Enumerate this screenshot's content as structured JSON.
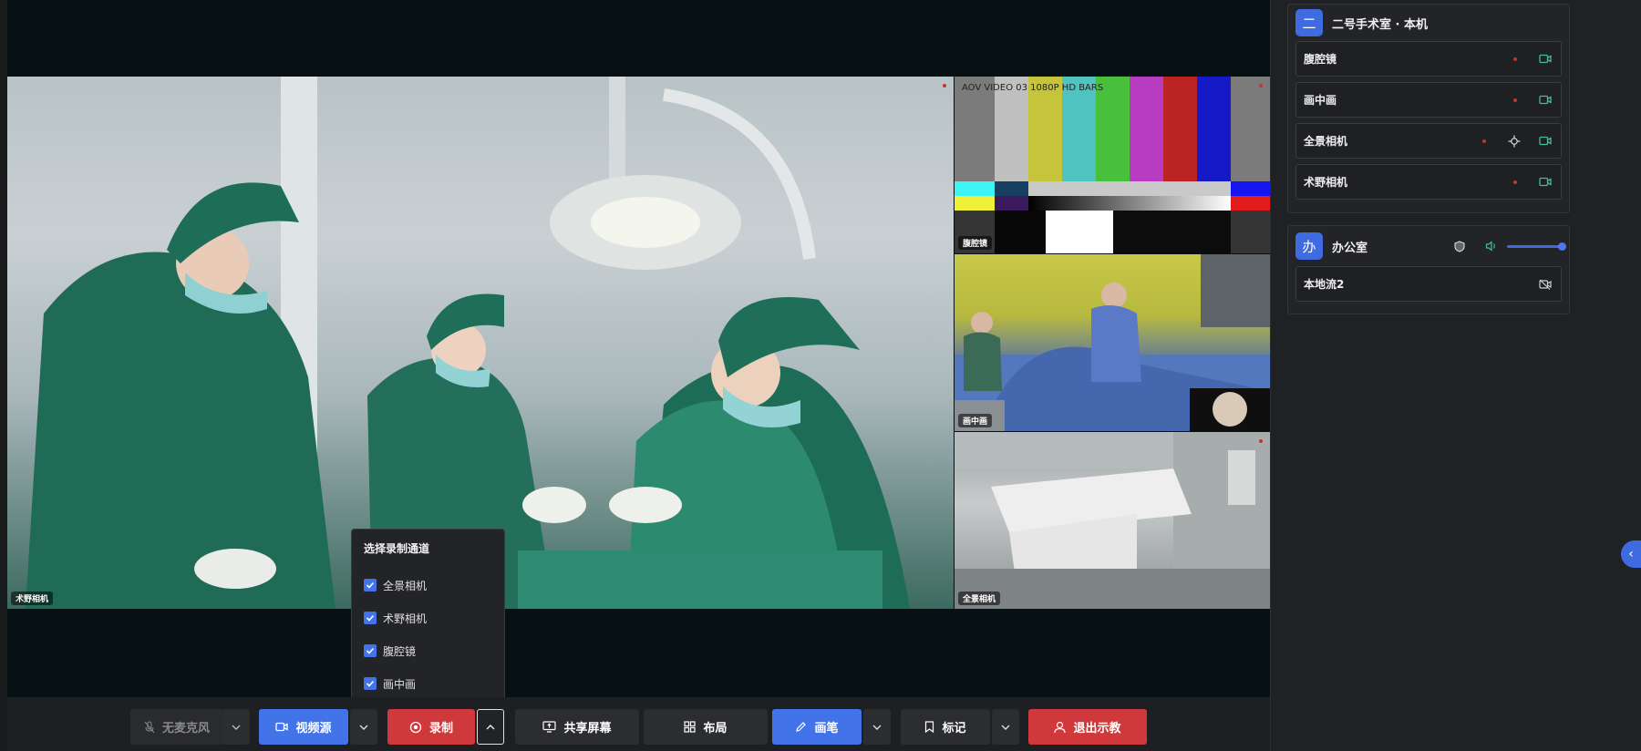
{
  "stage": {
    "main": {
      "label": "术野相机"
    },
    "bars": {
      "overlay_text": "AOV VIDEO 03 1080P HD BARS",
      "label": "腹腔镜"
    },
    "room": {
      "label": "画中画"
    },
    "corridor": {
      "label": "全景相机"
    }
  },
  "sidebar": {
    "group1": {
      "badge": "二",
      "title": "二号手术室 · 本机",
      "channels": [
        {
          "name": "腹腔镜"
        },
        {
          "name": "画中画"
        },
        {
          "name": "全景相机"
        },
        {
          "name": "术野相机"
        }
      ]
    },
    "group2": {
      "badge": "办",
      "title": "办公室",
      "volume_level": 1.0,
      "channels": [
        {
          "name": "本地流2"
        }
      ]
    },
    "collapse_glyph": "‹"
  },
  "popup": {
    "title": "选择录制通道",
    "options": [
      {
        "label": "全景相机",
        "checked": true
      },
      {
        "label": "术野相机",
        "checked": true
      },
      {
        "label": "腹腔镜",
        "checked": true
      },
      {
        "label": "画中画",
        "checked": true
      }
    ]
  },
  "toolbar": {
    "mic_label": "无麦克风",
    "video_source_label": "视频源",
    "record_label": "录制",
    "share_screen_label": "共享屏幕",
    "layout_label": "布局",
    "pen_label": "画笔",
    "mark_label": "标记",
    "exit_label": "退出示教"
  },
  "colors": {
    "accent": "#4373e8",
    "danger": "#d0393c",
    "sidebar_bg": "#202124"
  }
}
